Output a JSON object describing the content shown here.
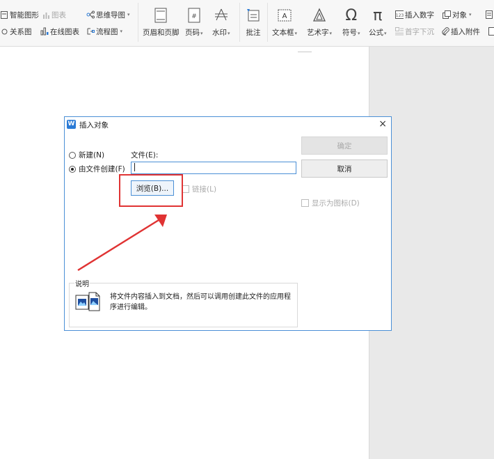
{
  "ribbon": {
    "left": {
      "smart_shape": "智能图形",
      "chart": "图表",
      "mind_map": "思维导图",
      "relation_map": "关系图",
      "online_chart": "在线图表",
      "flowchart": "流程图"
    },
    "buttons": {
      "header_footer": "页眉和页脚",
      "page_number": "页码",
      "watermark": "水印",
      "comment": "批注",
      "text_box": "文本框",
      "word_art": "艺术字",
      "symbol": "符号",
      "formula": "公式"
    },
    "right": {
      "insert_number": "插入数字",
      "object": "对象",
      "drop_cap": "首字下沉",
      "insert_attachment": "插入附件"
    }
  },
  "dialog": {
    "title": "插入对象",
    "close": "×",
    "radio_new": "新建(N)",
    "radio_from_file": "由文件创建(F)",
    "file_label": "文件(E):",
    "file_value": "",
    "ok": "确定",
    "cancel": "取消",
    "browse": "浏览(B)...",
    "link": "链接(L)",
    "display_as_icon": "显示为图标(D)",
    "desc_label": "说明",
    "desc_text": "将文件内容插入到文档，然后可以调用创建此文件的应用程序进行编辑。"
  },
  "colors": {
    "accent": "#4a8fd6",
    "highlight": "#e03333",
    "ribbon_bg": "#f7f7f7",
    "side_gray": "#e9e9e9"
  }
}
